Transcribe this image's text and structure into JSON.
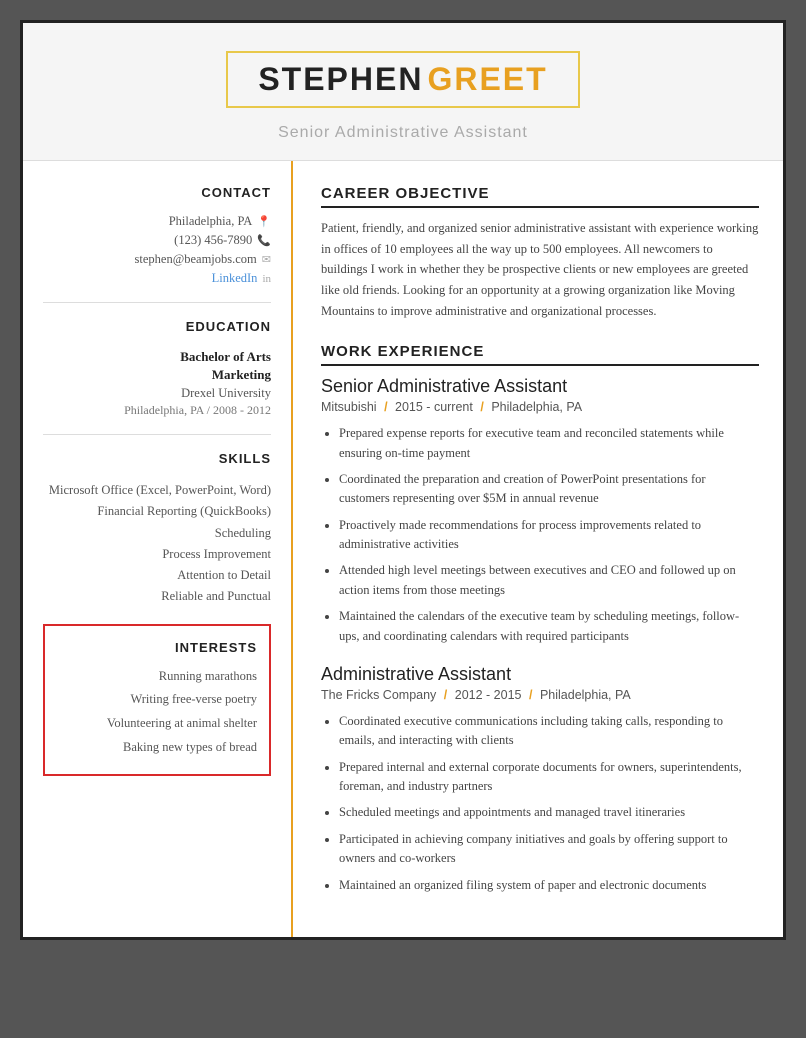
{
  "header": {
    "name_first": "STEPHEN",
    "name_last": "GREET",
    "title": "Senior Administrative Assistant"
  },
  "contact": {
    "section_label": "Contact",
    "city": "Philadelphia, PA",
    "phone": "(123) 456-7890",
    "email": "stephen@beamjobs.com",
    "linkedin_label": "LinkedIn"
  },
  "education": {
    "section_label": "Education",
    "degree": "Bachelor of Arts",
    "major": "Marketing",
    "school": "Drexel University",
    "location_year": "Philadelphia, PA  /  2008 - 2012"
  },
  "skills": {
    "section_label": "Skills",
    "items": [
      "Microsoft Office (Excel, PowerPoint, Word)",
      "Financial Reporting (QuickBooks)",
      "Scheduling",
      "Process Improvement",
      "Attention to Detail",
      "Reliable and Punctual"
    ]
  },
  "interests": {
    "section_label": "Interests",
    "items": [
      "Running marathons",
      "Writing free-verse poetry",
      "Volunteering at animal shelter",
      "Baking new types of bread"
    ]
  },
  "career_objective": {
    "section_label": "Career Objective",
    "text": "Patient, friendly, and organized senior administrative assistant with experience working in offices of 10 employees all the way up to 500 employees. All newcomers to buildings I work in whether they be prospective clients or new employees are greeted like old friends. Looking for an opportunity at a growing organization like Moving Mountains to improve administrative and organizational processes."
  },
  "work_experience": {
    "section_label": "Work Experience",
    "jobs": [
      {
        "title": "Senior Administrative Assistant",
        "company": "Mitsubishi",
        "years": "2015 - current",
        "location": "Philadelphia, PA",
        "bullets": [
          "Prepared expense reports for executive team and reconciled statements while ensuring on-time payment",
          "Coordinated the preparation and creation of PowerPoint presentations for customers representing over $5M in annual revenue",
          "Proactively made recommendations for process improvements related to administrative activities",
          "Attended high level meetings between executives and CEO and followed up on action items from those meetings",
          "Maintained the calendars of the executive team by scheduling meetings, follow-ups, and coordinating calendars with required participants"
        ]
      },
      {
        "title": "Administrative Assistant",
        "company": "The Fricks Company",
        "years": "2012 - 2015",
        "location": "Philadelphia, PA",
        "bullets": [
          "Coordinated executive communications including taking calls, responding to emails, and interacting with clients",
          "Prepared internal and external corporate documents for owners, superintendents, foreman, and industry partners",
          "Scheduled meetings and appointments and managed travel itineraries",
          "Participated in achieving company initiatives and goals by offering support to owners and co-workers",
          "Maintained an organized filing system of paper and electronic documents"
        ]
      }
    ]
  }
}
